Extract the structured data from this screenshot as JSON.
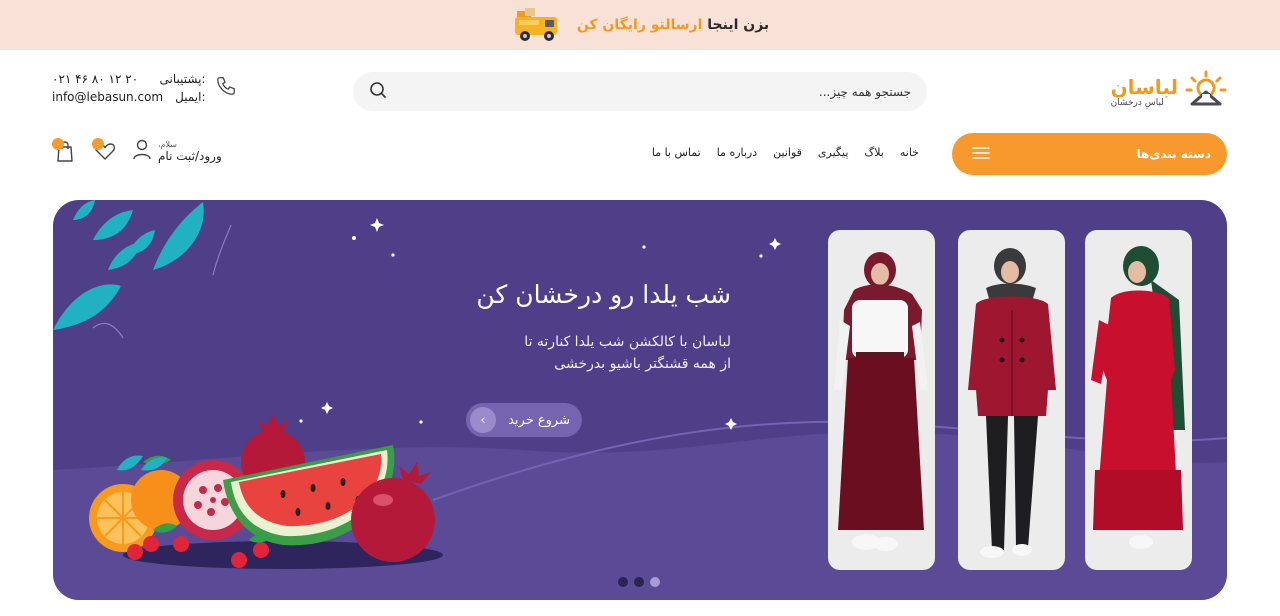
{
  "promo": {
    "prefix": "بزن اینجا",
    "highlight": "ارسالتو رایگان کن"
  },
  "logo": {
    "brand": "لباسان",
    "slogan": "لباسِ درخشان"
  },
  "search": {
    "placeholder": "جستجو همه چیز..."
  },
  "contact": {
    "support_label": "پشتیبانی:",
    "support_value": "۰۲۱ ۴۶ ۸۰ ۱۲ ۲۰",
    "email_label": "ایمیل:",
    "email_value": "info@lebasun.com"
  },
  "nav": {
    "categories_label": "دسته بندی‌ها",
    "items": [
      "خانه",
      "بلاگ",
      "پیگیری",
      "قوانین",
      "درباره ما",
      "تماس با ما"
    ]
  },
  "user": {
    "greeting": "سلام،",
    "login_label": "ورود/ثبت نام",
    "wishlist_count": "۰",
    "cart_count": "۰"
  },
  "hero": {
    "title": "شب یلدا رو درخشان کن",
    "subtitle_line1": "لباسان با کالکشن شب یلدا کنارته تا",
    "subtitle_line2": "از همه قشنگتر باشیو بدرخشی",
    "cta_label": "شروع خرید",
    "slides_total": 3,
    "active_slide": 3
  },
  "colors": {
    "accent": "#f7992c",
    "hero_bg": "#4f3f89",
    "promo_bg": "#f8e1d6"
  },
  "icons": [
    "truck-icon",
    "logo-hanger-icon",
    "search-icon",
    "phone-icon",
    "menu-icon",
    "user-icon",
    "heart-icon",
    "cart-icon",
    "arrow-icon"
  ]
}
